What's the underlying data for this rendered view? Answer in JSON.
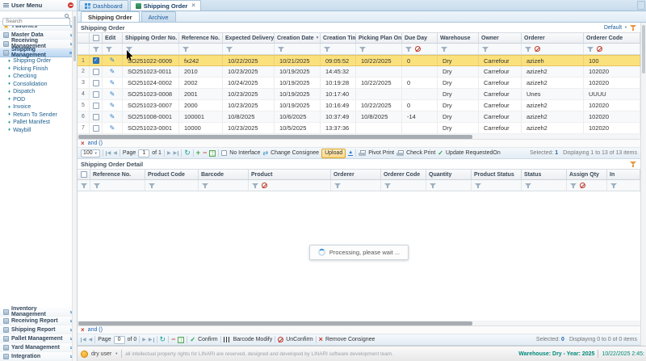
{
  "icons": {
    "user-menu-icon": "hamburger bars",
    "logout-icon": "red circle with dash",
    "search-icon": "magnifier",
    "favorites-icon": "★",
    "group-chevron-icon": "» rotated",
    "submenu-bullet-icon": "♦",
    "dashboard-icon": "2x2 blue grid",
    "shipping-order-icon": "green square",
    "close-icon": "×",
    "edit-icon": "✎",
    "filter-funnel-icon": "funnel",
    "clear-filter-icon": "circle-slash",
    "sort-desc-icon": "▼",
    "refresh-icon": "↻",
    "add-icon": "+",
    "remove-icon": "−",
    "grid-icon": "green table",
    "swap-icon": "⇄",
    "upload-icon": "▲ underlined",
    "printer-icon": "printer",
    "check-icon": "✓",
    "barcode-icon": "vertical bars",
    "spinner-icon": "loading circle"
  },
  "tabs": {
    "items": [
      {
        "label": "Dashboard"
      },
      {
        "label": "Shipping Order"
      }
    ]
  },
  "subtabs": {
    "items": [
      "Shipping Order",
      "Archive"
    ]
  },
  "sidebar": {
    "title": "User Menu",
    "search_placeholder": "Search",
    "groups_top": [
      {
        "label": "Favorites",
        "is_star": true
      },
      {
        "label": "Master Data"
      },
      {
        "label": "Receiving Management"
      }
    ],
    "active_group": {
      "label": "Shipping Management"
    },
    "active_items": [
      {
        "label": "Shipping Order"
      },
      {
        "label": "Picking Finish"
      },
      {
        "label": "Checking"
      },
      {
        "label": "Consolidation"
      },
      {
        "label": "Dispatch"
      },
      {
        "label": "POD"
      },
      {
        "label": "Invoice"
      },
      {
        "label": "Return To Sender"
      },
      {
        "label": "Pallet Manifest"
      },
      {
        "label": "Waybill"
      }
    ],
    "groups_bottom": [
      {
        "label": "Inventory Management"
      },
      {
        "label": "Receiving Report"
      },
      {
        "label": "Shipping Report"
      },
      {
        "label": "Pallet Management"
      },
      {
        "label": "Yard Management"
      },
      {
        "label": "Integration"
      }
    ]
  },
  "master_grid": {
    "title": "Shipping Order",
    "view_selector": "Default",
    "columns": [
      "Edit",
      "Shipping Order No.",
      "Reference No.",
      "Expected Delivery Date",
      "Creation Date",
      "Creation Time",
      "Picking Plan On",
      "Due Day",
      "Warehouse",
      "Owner",
      "Orderer",
      "Orderer Code"
    ],
    "filter_expression": "and ()",
    "rows": [
      {
        "num": "1",
        "selected": true,
        "order_no": "SO251022-0009",
        "reference": "fx242",
        "expected_delivery": "10/22/2025",
        "creation_date": "10/21/2025",
        "creation_time": "09:05:52",
        "picking_plan": "10/22/2025",
        "due_day": "0",
        "warehouse": "Dry",
        "owner": "Carrefour",
        "orderer": "azizeh",
        "orderer_code": "100"
      },
      {
        "num": "2",
        "order_no": "SO251023-0011",
        "reference": "2010",
        "expected_delivery": "10/23/2025",
        "creation_date": "10/19/2025",
        "creation_time": "14:45:32",
        "picking_plan": "",
        "due_day": "",
        "warehouse": "Dry",
        "owner": "Carrefour",
        "orderer": "azizeh2",
        "orderer_code": "102020"
      },
      {
        "num": "3",
        "order_no": "SO251024-0002",
        "reference": "2002",
        "expected_delivery": "10/24/2025",
        "creation_date": "10/19/2025",
        "creation_time": "10:19:28",
        "picking_plan": "10/22/2025",
        "due_day": "0",
        "warehouse": "Dry",
        "owner": "Carrefour",
        "orderer": "azizeh2",
        "orderer_code": "102020"
      },
      {
        "num": "4",
        "order_no": "SO251023-0008",
        "reference": "2001",
        "expected_delivery": "10/23/2025",
        "creation_date": "10/19/2025",
        "creation_time": "10:17:40",
        "picking_plan": "",
        "due_day": "",
        "warehouse": "Dry",
        "owner": "Carrefour",
        "orderer": "Unes",
        "orderer_code": "UUUU"
      },
      {
        "num": "5",
        "order_no": "SO251023-0007",
        "reference": "2000",
        "expected_delivery": "10/23/2025",
        "creation_date": "10/19/2025",
        "creation_time": "10:16:49",
        "picking_plan": "10/22/2025",
        "due_day": "0",
        "warehouse": "Dry",
        "owner": "Carrefour",
        "orderer": "azizeh2",
        "orderer_code": "102020"
      },
      {
        "num": "6",
        "order_no": "SO251008-0001",
        "reference": "100001",
        "expected_delivery": "10/8/2025",
        "creation_date": "10/6/2025",
        "creation_time": "10:37:49",
        "picking_plan": "10/8/2025",
        "due_day": "-14",
        "warehouse": "Dry",
        "owner": "Carrefour",
        "orderer": "azizeh2",
        "orderer_code": "102020"
      },
      {
        "num": "7",
        "order_no": "SO251023-0001",
        "reference": "10000",
        "expected_delivery": "10/23/2025",
        "creation_date": "10/5/2025",
        "creation_time": "13:37:36",
        "picking_plan": "",
        "due_day": "",
        "warehouse": "Dry",
        "owner": "Carrefour",
        "orderer": "azizeh2",
        "orderer_code": "102020"
      }
    ],
    "toolbar": {
      "page_size": "100",
      "page_label": "Page",
      "page_value": "1",
      "of_label": "of 1",
      "no_interface": "No Interface",
      "change_consignee": "Change Consignee",
      "upload": "Upload",
      "pivot_print": "Pivot Print",
      "check_print": "Check Print",
      "update_requested_on": "Update RequestedOn",
      "selected_label": "Selected:",
      "selected_value": "1",
      "displaying": "Displaying 1 to 13 of 13 items"
    }
  },
  "detail_grid": {
    "title": "Shipping Order Detail",
    "columns": [
      "Reference No.",
      "Product Code",
      "Barcode",
      "Product",
      "Orderer",
      "Orderer Code",
      "Quantity",
      "Product Status",
      "Status",
      "Assign Qty",
      "In"
    ],
    "filter_expression": "and ()",
    "loading_text": "Processing, please wait ...",
    "toolbar": {
      "page_label": "Page",
      "page_value": "0",
      "of_label": "of 0",
      "confirm": "Confirm",
      "barcode_modify": "Barcode Modify",
      "unconfirm": "UnConfirm",
      "remove_consignee": "Remove Consignee",
      "selected_label": "Selected:",
      "selected_value": "0",
      "displaying": "Displaying 0 to 0 of 0 items"
    }
  },
  "statusbar": {
    "user": "dry user",
    "copyright": "all intellectual property rights for LINARI are reserved, designed and developed by LINARI software development team.",
    "warehouse_year": "Warehouse: Dry - Year: 2025",
    "datetime": "10/22/2025 2:45:"
  }
}
